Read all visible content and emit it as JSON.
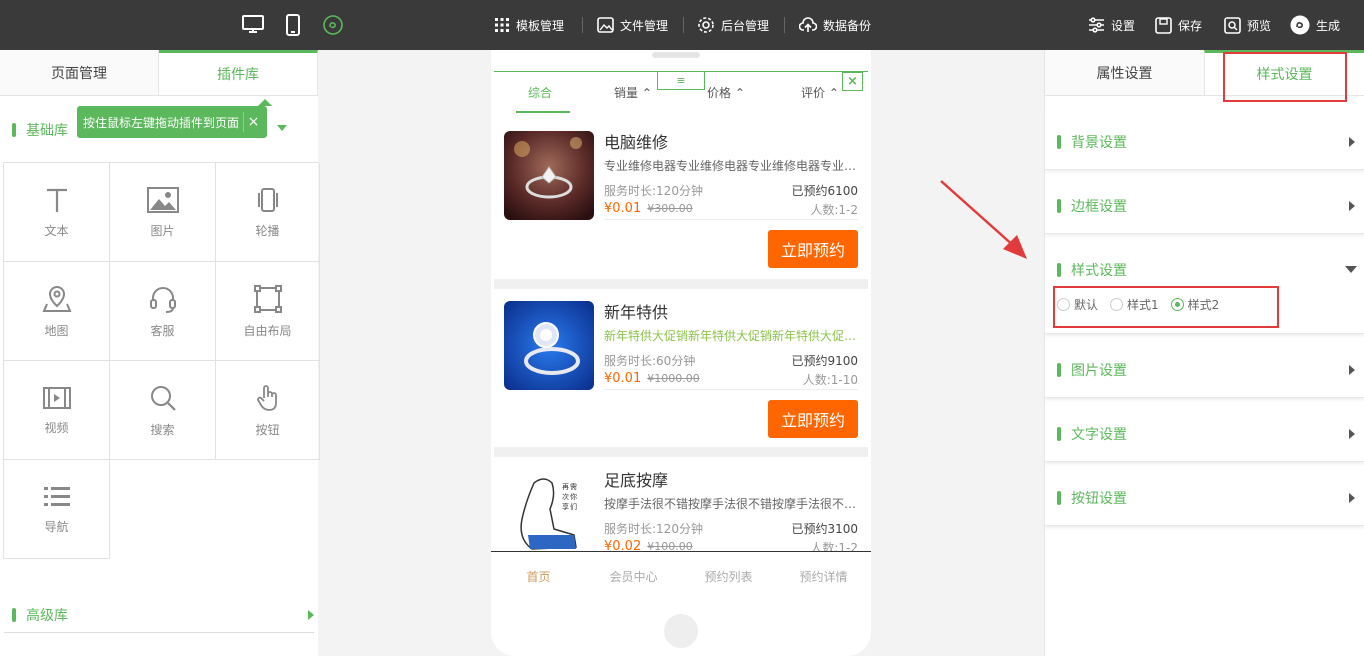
{
  "toolbar": {
    "template_label": "模板管理",
    "file_label": "文件管理",
    "backend_label": "后台管理",
    "backup_label": "数据备份",
    "settings_label": "设置",
    "save_label": "保存",
    "preview_label": "预览",
    "generate_label": "生成"
  },
  "left_panel": {
    "tabs": [
      "页面管理",
      "插件库"
    ],
    "basic_title": "基础库",
    "tip": "按住鼠标左键拖动插件到页面",
    "tip_close": "×",
    "plugins": [
      "文本",
      "图片",
      "轮播",
      "地图",
      "客服",
      "自由布局",
      "视频",
      "搜索",
      "按钮",
      "导航"
    ],
    "advanced_title": "高级库"
  },
  "phone": {
    "filters": [
      "综合",
      "销量",
      "价格",
      "评价"
    ],
    "filter_menu": "≡",
    "close": "×",
    "products": [
      {
        "name": "电脑维修",
        "desc": "专业维修电器专业维修电器专业维修电器专业维修电器",
        "duration": "服务时长:120分钟",
        "booked": "已预约6100",
        "price": "¥0.01",
        "old_price": "¥300.00",
        "people": "人数:1-2",
        "button": "立即预约"
      },
      {
        "name": "新年特供",
        "desc": "新年特供大促销新年特供大促销新年特供大促销新年特供",
        "duration": "服务时长:60分钟",
        "booked": "已预约9100",
        "price": "¥0.01",
        "old_price": "¥1000.00",
        "people": "人数:1-10",
        "button": "立即预约"
      },
      {
        "name": "足底按摩",
        "desc": "按摩手法很不错按摩手法很不错按摩手法很不错按摩手法",
        "duration": "服务时长:120分钟",
        "booked": "已预约3100",
        "price": "¥0.02",
        "old_price": "¥100.00",
        "people": "人数:1-2"
      }
    ],
    "bottom_nav": [
      "首页",
      "会员中心",
      "预约列表",
      "预约详情"
    ]
  },
  "right_panel": {
    "tabs": [
      "属性设置",
      "样式设置"
    ],
    "sections": [
      "背景设置",
      "边框设置",
      "样式设置",
      "图片设置",
      "文字设置",
      "按钮设置"
    ],
    "style_options": [
      "默认",
      "样式1",
      "样式2"
    ],
    "selected_style": "样式2"
  },
  "colors": {
    "accent": "#5cb85c",
    "topbar": "#3a3a3a",
    "button": "#ff6600",
    "highlight": "#e23b3b"
  }
}
